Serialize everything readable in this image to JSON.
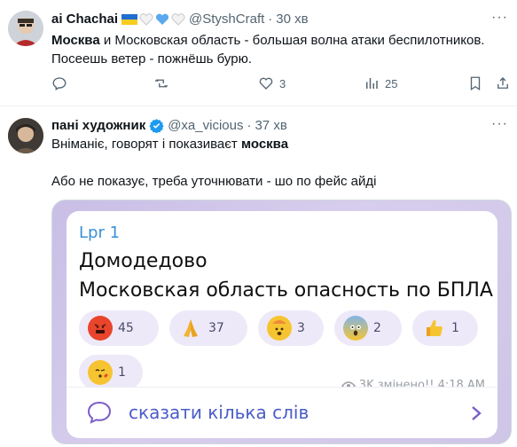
{
  "tweets": [
    {
      "name": "ai Chachai",
      "handle": "@StyshCraft",
      "time": "30 хв",
      "name_emojis": "🇺🇦 🤍💙🤍",
      "text_bold": "Москва",
      "text_rest": " и Московская область - большая волна атаки беспилотников.",
      "text_line2": "Посеешь ветер - пожнёшь бурю.",
      "actions": {
        "reply": "",
        "retweet": "",
        "likes": "3",
        "views": "25"
      }
    },
    {
      "name": "пані художник",
      "handle": "@xa_vicious",
      "time": "37 хв",
      "text_line1_pre": "Вніманіє, говорят і показиваєт ",
      "text_line1_bold": "москва",
      "text_line2": "Або не показує, треба уточнювати - шо по фейс айді"
    }
  ],
  "telegram": {
    "channel": "Lpr 1",
    "line1": "Домодедово",
    "line2": "Московская область опасность по БПЛА",
    "reactions": [
      {
        "icon": "angry-face-icon",
        "count": "45",
        "color": "#e8452c"
      },
      {
        "icon": "pray-icon",
        "count": "37",
        "color": "#f2b233"
      },
      {
        "icon": "exploding-head-icon",
        "count": "3",
        "color": "#f2b233"
      },
      {
        "icon": "scream-face-icon",
        "count": "2",
        "color": "#7fb4e8"
      },
      {
        "icon": "thumbs-up-icon",
        "count": "1",
        "color": "#f2b233"
      },
      {
        "icon": "kiss-face-icon",
        "count": "1",
        "color": "#f2b233"
      }
    ],
    "meta": "3K змінено!! 4:18 AM",
    "comment_placeholder": "сказати кілька слів"
  },
  "colors": {
    "accent": "#1d9bf0",
    "telegram_blue": "#3a8fd6",
    "comment_purple": "#4a5cc8"
  }
}
